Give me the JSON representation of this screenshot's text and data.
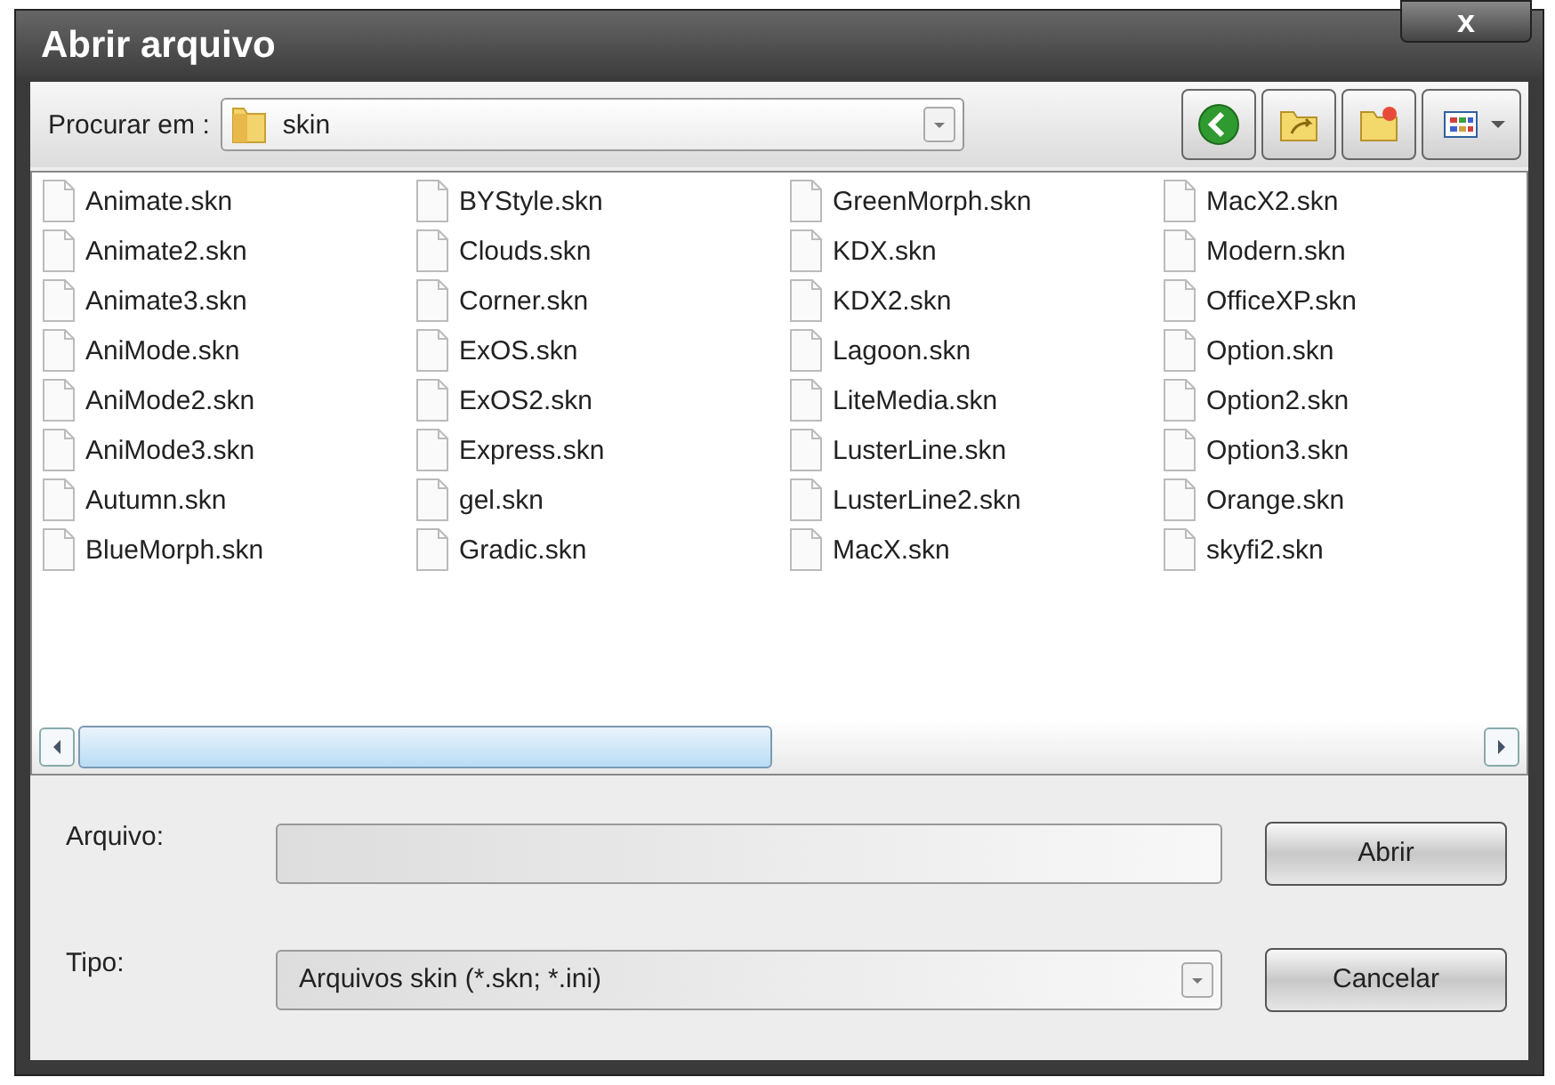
{
  "window": {
    "title": "Abrir arquivo",
    "close": "x"
  },
  "look_in": {
    "label": "Procurar em :",
    "value": "skin"
  },
  "file_columns": [
    [
      "Animate.skn",
      "Animate2.skn",
      "Animate3.skn",
      "AniMode.skn",
      "AniMode2.skn",
      "AniMode3.skn",
      "Autumn.skn",
      "BlueMorph.skn"
    ],
    [
      "BYStyle.skn",
      "Clouds.skn",
      "Corner.skn",
      "ExOS.skn",
      "ExOS2.skn",
      "Express.skn",
      "gel.skn",
      "Gradic.skn"
    ],
    [
      "GreenMorph.skn",
      "KDX.skn",
      "KDX2.skn",
      "Lagoon.skn",
      "LiteMedia.skn",
      "LusterLine.skn",
      "LusterLine2.skn",
      "MacX.skn"
    ],
    [
      "MacX2.skn",
      "Modern.skn",
      "OfficeXP.skn",
      "Option.skn",
      "Option2.skn",
      "Option3.skn",
      "Orange.skn",
      "skyfi2.skn"
    ]
  ],
  "file_name": {
    "label": "Arquivo:"
  },
  "file_type": {
    "label": "Tipo:",
    "value": "Arquivos skin (*.skn; *.ini)"
  },
  "buttons": [
    "Abrir",
    "Cancelar"
  ]
}
